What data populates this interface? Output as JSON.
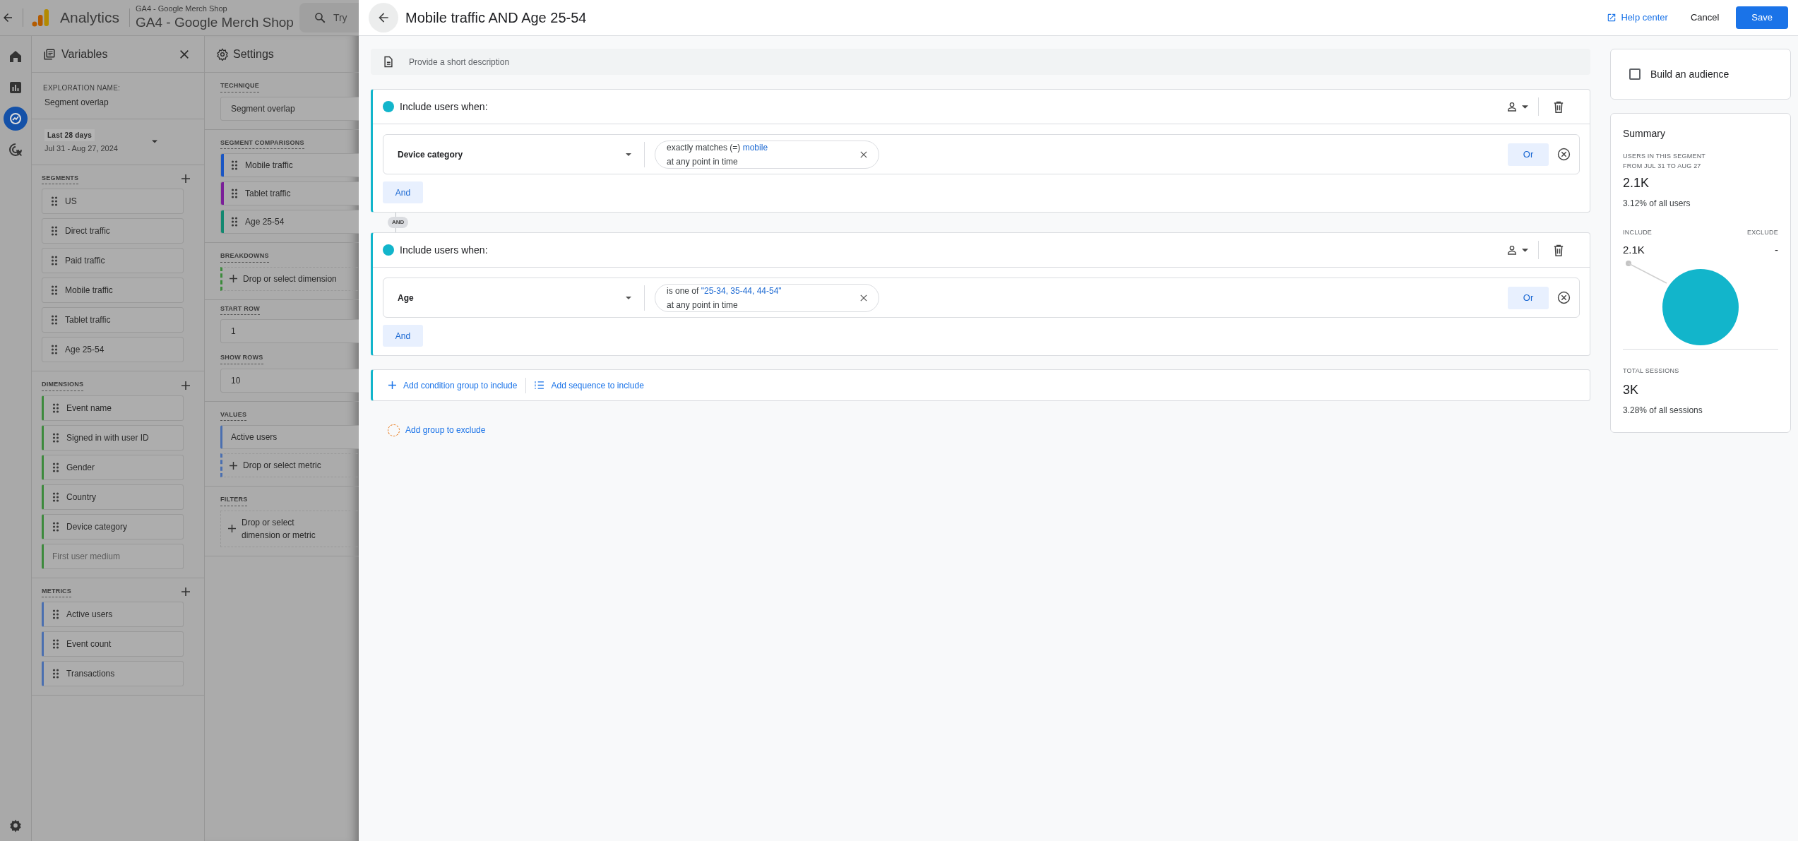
{
  "app_bar": {
    "product": "Analytics",
    "account": "GA4 - Google Merch Shop",
    "property": "GA4 - Google Merch Shop",
    "search_placeholder": "Try"
  },
  "nav_rail": [
    {
      "kind": "home",
      "selected": false
    },
    {
      "kind": "reports",
      "selected": false
    },
    {
      "kind": "explore",
      "selected": true
    },
    {
      "kind": "advertising",
      "selected": false
    }
  ],
  "variables_panel": {
    "title": "Variables",
    "exploration_name_label": "EXPLORATION NAME:",
    "exploration_name": "Segment overlap",
    "date_preset": "Last 28 days",
    "date_range": "Jul 31 - Aug 27, 2024",
    "segments": {
      "heading": "SEGMENTS",
      "items": [
        {
          "label": "US",
          "disabled": false
        },
        {
          "label": "Direct traffic",
          "disabled": false
        },
        {
          "label": "Paid traffic",
          "disabled": false
        },
        {
          "label": "Mobile traffic",
          "disabled": false
        },
        {
          "label": "Tablet traffic",
          "disabled": false
        },
        {
          "label": "Age 25-54",
          "disabled": false
        }
      ]
    },
    "dimensions": {
      "heading": "DIMENSIONS",
      "items": [
        {
          "label": "Event name",
          "disabled": false
        },
        {
          "label": "Signed in with user ID",
          "disabled": false
        },
        {
          "label": "Gender",
          "disabled": false
        },
        {
          "label": "Country",
          "disabled": false
        },
        {
          "label": "Device category",
          "disabled": false
        },
        {
          "label": "First user medium",
          "disabled": true
        }
      ]
    },
    "metrics": {
      "heading": "METRICS",
      "items": [
        {
          "label": "Active users",
          "disabled": false
        },
        {
          "label": "Event count",
          "disabled": false
        },
        {
          "label": "Transactions",
          "disabled": false
        }
      ]
    }
  },
  "settings_panel": {
    "title": "Settings",
    "technique_label": "TECHNIQUE",
    "technique": "Segment overlap",
    "segment_comparisons_label": "SEGMENT COMPARISONS",
    "segment_comparisons": [
      {
        "label": "Mobile traffic",
        "color": "#1a56c4"
      },
      {
        "label": "Tablet traffic",
        "color": "#7b1f99"
      },
      {
        "label": "Age 25-54",
        "color": "#128870"
      }
    ],
    "breakdowns_label": "BREAKDOWNS",
    "breakdowns_placeholder": "Drop or select dimension",
    "start_row_label": "START ROW",
    "start_row": "1",
    "show_rows_label": "SHOW ROWS",
    "show_rows": "10",
    "values_label": "VALUES",
    "values": [
      "Active users"
    ],
    "values_placeholder": "Drop or select metric",
    "filters_label": "FILTERS",
    "filters_placeholder": "Drop or select dimension or metric"
  },
  "segment_editor": {
    "title": "Mobile traffic AND Age 25-54",
    "help_link": "Help center",
    "cancel": "Cancel",
    "save": "Save",
    "description_placeholder": "Provide a short description",
    "include_groups": [
      {
        "heading": "Include users when:",
        "conditions": [
          {
            "dimension": "Device category",
            "operator": "exactly matches (=)",
            "value": "mobile",
            "scope": "at any point in time",
            "or_button": "Or"
          }
        ],
        "and_button": "And"
      },
      {
        "heading": "Include users when:",
        "conditions": [
          {
            "dimension": "Age",
            "operator": "is one of",
            "value": "\"25-34, 35-44, 44-54\"",
            "scope": "at any point in time",
            "or_button": "Or"
          }
        ],
        "and_button": "And"
      }
    ],
    "group_joiner": "AND",
    "add_condition_group": "Add condition group to include",
    "add_sequence": "Add sequence to include",
    "add_exclude": "Add group to exclude"
  },
  "build_audience": {
    "label": "Build an audience",
    "checked": false
  },
  "summary": {
    "title": "Summary",
    "users_label": "USERS IN THIS SEGMENT",
    "users_period": "FROM JUL 31 TO AUG 27",
    "users_value": "2.1K",
    "users_share": "3.12% of all users",
    "include_label": "INCLUDE",
    "exclude_label": "EXCLUDE",
    "include_value": "2.1K",
    "exclude_value": "-",
    "sessions_label": "TOTAL SESSIONS",
    "sessions_value": "3K",
    "sessions_share": "3.28% of all sessions"
  }
}
